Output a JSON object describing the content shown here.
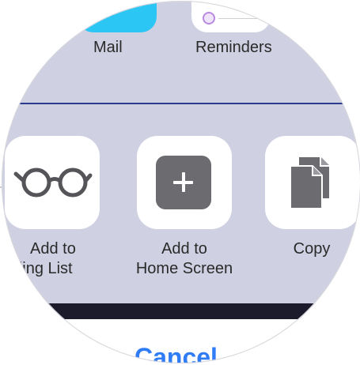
{
  "share_sheet": {
    "apps": [
      {
        "label": "Mail",
        "icon": "mail-icon"
      },
      {
        "label": "Reminders",
        "icon": "reminders-icon"
      }
    ],
    "actions": {
      "reading_list": {
        "line1": "Add to",
        "line2": "ading List",
        "icon": "glasses-icon"
      },
      "home_screen": {
        "line1": "Add to",
        "line2": "Home Screen",
        "icon": "plus-square-icon"
      },
      "copy": {
        "label": "Copy",
        "icon": "copy-icon"
      }
    },
    "cancel_label": "Cancel"
  },
  "colors": {
    "sheet_background": "#cfd0e2",
    "divider": "#2b3a8a",
    "mail_icon": "#2cc6f5",
    "icon_gray": "#6b6b70",
    "cancel_blue": "#2f7cf6",
    "dark_band": "#1c1b2c"
  }
}
